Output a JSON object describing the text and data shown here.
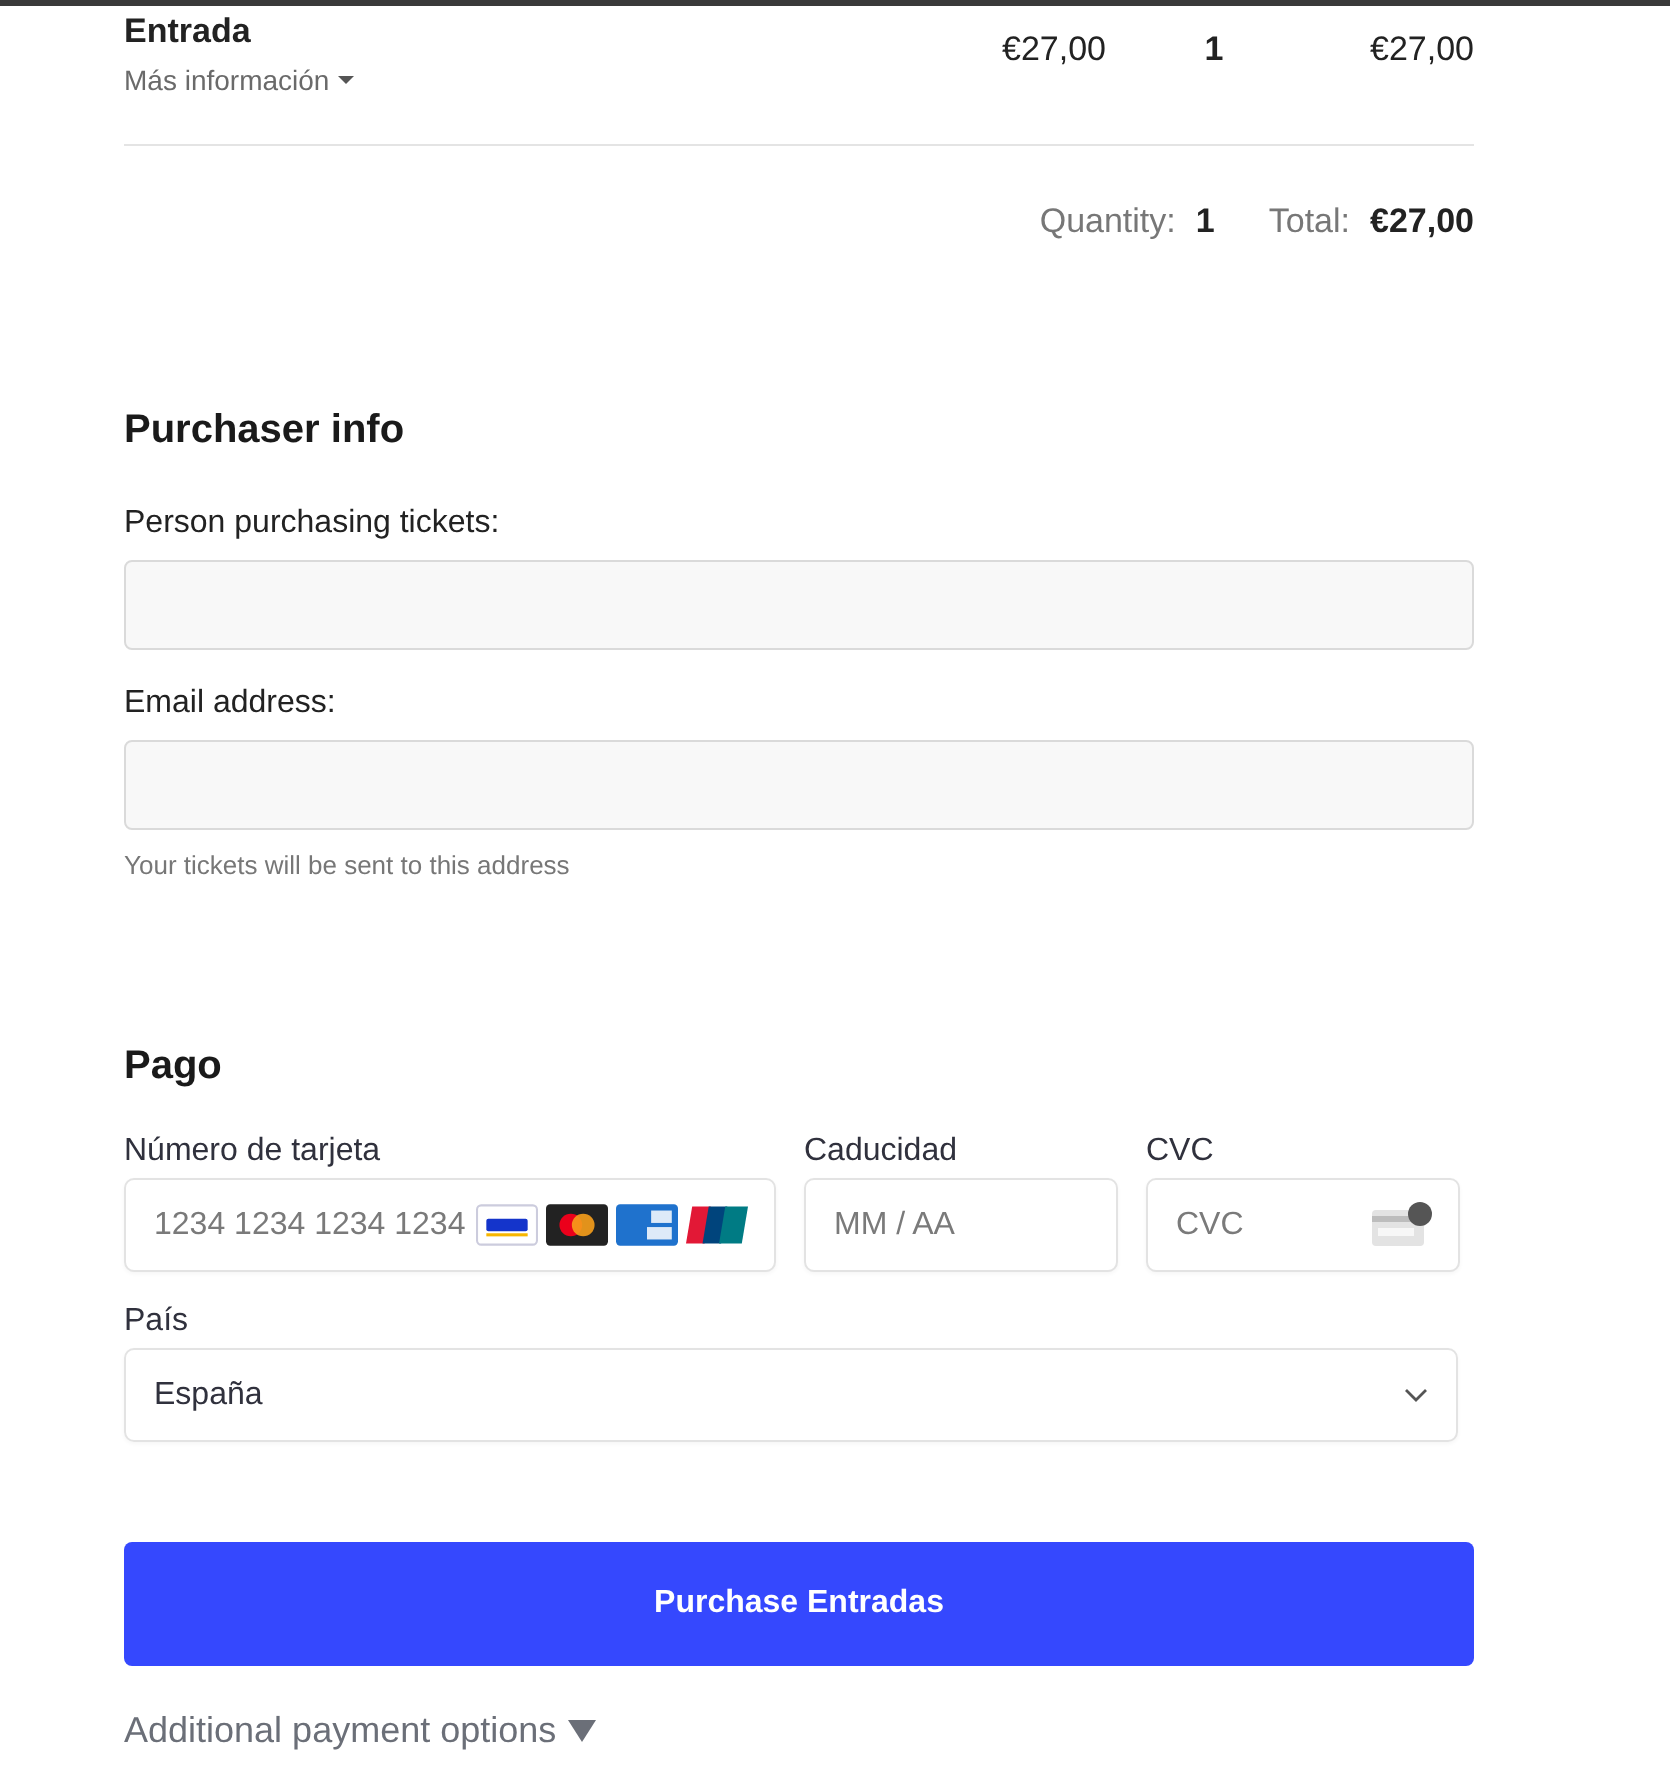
{
  "order_item": {
    "name": "Entrada",
    "more_info": "Más información",
    "price": "€27,00",
    "quantity": "1",
    "total": "€27,00"
  },
  "summary": {
    "quantity_label": "Quantity:",
    "quantity": "1",
    "total_label": "Total:",
    "total": "€27,00"
  },
  "purchaser": {
    "heading": "Purchaser info",
    "fields": [
      {
        "label": "Person purchasing tickets:"
      },
      {
        "label": "Email address:",
        "hint": "Your tickets will be sent to this address"
      }
    ]
  },
  "payment": {
    "heading": "Pago",
    "card_number": {
      "label": "Número de tarjeta",
      "placeholder": "1234 1234 1234 1234"
    },
    "expiry": {
      "label": "Caducidad",
      "placeholder": "MM / AA"
    },
    "cvc": {
      "label": "CVC",
      "placeholder": "CVC"
    },
    "country": {
      "label": "País",
      "value": "España"
    }
  },
  "purchase_button": "Purchase Entradas",
  "additional_options": "Additional payment options"
}
